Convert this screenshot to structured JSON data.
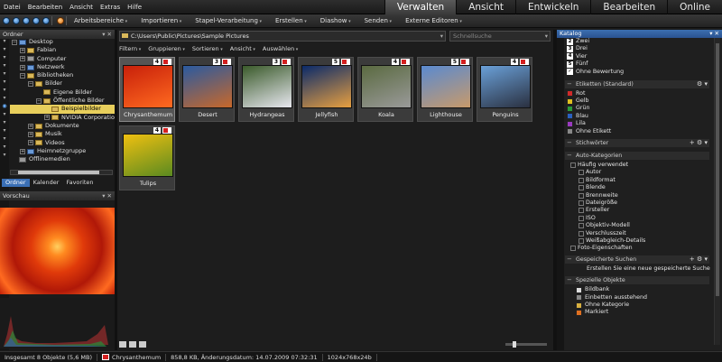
{
  "menu": [
    "Datei",
    "Bearbeiten",
    "Ansicht",
    "Extras",
    "Hilfe"
  ],
  "modes": [
    {
      "label": "Verwalten",
      "active": true
    },
    {
      "label": "Ansicht",
      "active": false
    },
    {
      "label": "Entwickeln",
      "active": false
    },
    {
      "label": "Bearbeiten",
      "active": false
    },
    {
      "label": "Online",
      "active": false
    }
  ],
  "toolbar": [
    "Arbeitsbereiche",
    "Importieren",
    "Stapel-Verarbeitung",
    "Erstellen",
    "Diashow",
    "Senden",
    "Externe Editoren"
  ],
  "folders": {
    "title": "Ordner",
    "items": [
      {
        "label": "Desktop",
        "level": 0,
        "exp": "−",
        "kind": "blue"
      },
      {
        "label": "Fabian",
        "level": 1,
        "exp": "+",
        "kind": "yellow"
      },
      {
        "label": "Computer",
        "level": 1,
        "exp": "+",
        "kind": "gray"
      },
      {
        "label": "Netzwerk",
        "level": 1,
        "exp": "+",
        "kind": "blue"
      },
      {
        "label": "Bibliotheken",
        "level": 1,
        "exp": "−",
        "kind": "yellow"
      },
      {
        "label": "Bilder",
        "level": 2,
        "exp": "−",
        "kind": "yellow"
      },
      {
        "label": "Eigene Bilder",
        "level": 3,
        "exp": "",
        "kind": "yellow"
      },
      {
        "label": "Öffentliche Bilder",
        "level": 3,
        "exp": "−",
        "kind": "yellow"
      },
      {
        "label": "Beispielbilder",
        "level": 4,
        "exp": "",
        "kind": "yellow",
        "selected": true
      },
      {
        "label": "NVIDIA Corporatio",
        "level": 4,
        "exp": "+",
        "kind": "yellow"
      },
      {
        "label": "Dokumente",
        "level": 2,
        "exp": "+",
        "kind": "yellow"
      },
      {
        "label": "Musik",
        "level": 2,
        "exp": "+",
        "kind": "yellow"
      },
      {
        "label": "Videos",
        "level": 2,
        "exp": "+",
        "kind": "yellow"
      },
      {
        "label": "Heimnetzgruppe",
        "level": 1,
        "exp": "+",
        "kind": "blue"
      },
      {
        "label": "Offlinemedien",
        "level": 0,
        "exp": "",
        "kind": "gray"
      }
    ],
    "tabs": [
      {
        "label": "Ordner",
        "active": true
      },
      {
        "label": "Kalender",
        "active": false
      },
      {
        "label": "Favoriten",
        "active": false
      }
    ]
  },
  "preview": {
    "title": "Vorschau"
  },
  "path": "C:\\Users\\Public\\Pictures\\Sample Pictures",
  "search_placeholder": "Schnellsuche",
  "filterbar": [
    "Filtern",
    "Gruppieren",
    "Sortieren",
    "Ansicht",
    "Auswählen"
  ],
  "thumbnails": [
    {
      "name": "Chrysanthemum",
      "rating": "4",
      "selected": true,
      "colors": [
        "#c8200a",
        "#ff6a20"
      ]
    },
    {
      "name": "Desert",
      "rating": "3",
      "colors": [
        "#2a5aa0",
        "#c8682a"
      ]
    },
    {
      "name": "Hydrangeas",
      "rating": "3",
      "colors": [
        "#3a5a2a",
        "#e8e8f0"
      ]
    },
    {
      "name": "Jellyfish",
      "rating": "5",
      "colors": [
        "#0a2a6a",
        "#e8a040"
      ]
    },
    {
      "name": "Koala",
      "rating": "4",
      "colors": [
        "#5a6a40",
        "#9a9a9a"
      ]
    },
    {
      "name": "Lighthouse",
      "rating": "5",
      "colors": [
        "#5a8ad0",
        "#c89a6a"
      ]
    },
    {
      "name": "Penguins",
      "rating": "4",
      "colors": [
        "#6aa0d8",
        "#2a3040"
      ]
    },
    {
      "name": "Tulips",
      "rating": "4",
      "colors": [
        "#f0c010",
        "#5a8a20"
      ]
    }
  ],
  "catalog": {
    "title": "Katalog",
    "ratings": [
      {
        "num": "2",
        "label": "Zwei"
      },
      {
        "num": "3",
        "label": "Drei"
      },
      {
        "num": "4",
        "label": "Vier"
      },
      {
        "num": "5",
        "label": "Fünf"
      },
      {
        "num": "✓",
        "label": "Ohne Bewertung"
      }
    ],
    "labels_section": "Etiketten (Standard)",
    "labels": [
      {
        "color": "#d02a2a",
        "label": "Rot"
      },
      {
        "color": "#e0c020",
        "label": "Gelb"
      },
      {
        "color": "#2a9a3a",
        "label": "Grün"
      },
      {
        "color": "#2a60c0",
        "label": "Blau"
      },
      {
        "color": "#9a3ac0",
        "label": "Lila"
      },
      {
        "color": "#888888",
        "label": "Ohne Etikett"
      }
    ],
    "keywords_section": "Stichwörter",
    "auto_section": "Auto-Kategorien",
    "auto_top": "Häufig verwendet",
    "auto_items": [
      "Autor",
      "Bildformat",
      "Blende",
      "Brennweite",
      "Dateigröße",
      "Ersteller",
      "ISO",
      "Objektiv-Modell",
      "Verschlusszeit",
      "Weißabgleich-Details"
    ],
    "auto_bottom": "Foto-Eigenschaften",
    "saved_section": "Gespeicherte Suchen",
    "saved_item": "Erstellen Sie eine neue gespeicherte Suche",
    "special_section": "Spezielle Objekte",
    "special": [
      {
        "label": "Bildbank",
        "color": "#dddddd"
      },
      {
        "label": "Einbetten ausstehend",
        "color": "#888888"
      },
      {
        "label": "Ohne Kategorie",
        "color": "#d8b040"
      },
      {
        "label": "Markiert",
        "color": "#e07020"
      }
    ]
  },
  "status": [
    "Insgesamt 8 Objekte (5,6 MB)",
    "Chrysanthemum",
    "858,8 KB, Änderungsdatum: 14.07.2009 07:32:31",
    "1024x768x24b"
  ]
}
